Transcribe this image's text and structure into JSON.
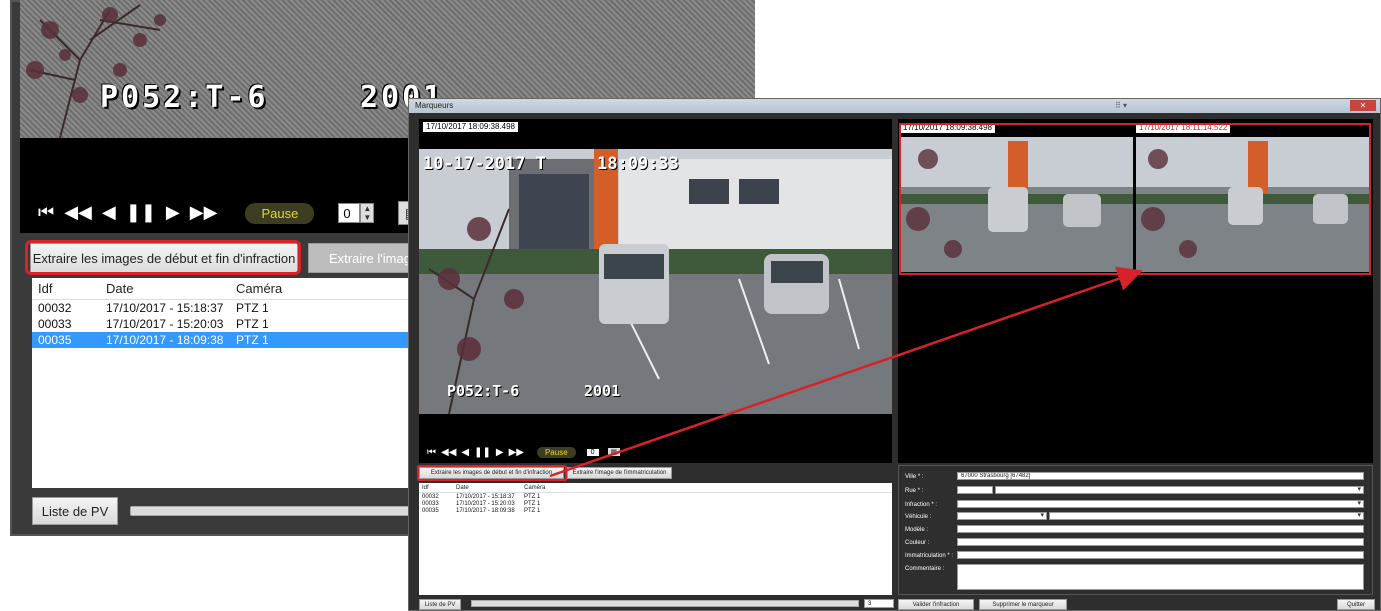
{
  "background_window": {
    "overlay_plate": "P052:T-6",
    "overlay_year": "2001",
    "controls": {
      "first": "⏮",
      "prev_fast": "◀◀",
      "prev": "◀",
      "pause_icon": "❚❚",
      "play": "▶",
      "next_fast": "▶▶",
      "pause_label": "Pause",
      "speed_value": "0"
    },
    "buttons": {
      "extract_label": "Extraire les images de début et fin d'infraction",
      "immat_label": "Extraire l'image d"
    },
    "table": {
      "headers": [
        "Idf",
        "Date",
        "Caméra"
      ],
      "rows": [
        {
          "idf": "00032",
          "date": "17/10/2017 - 15:18:37",
          "camera": "PTZ 1"
        },
        {
          "idf": "00033",
          "date": "17/10/2017 - 15:20:03",
          "camera": "PTZ 1"
        },
        {
          "idf": "00035",
          "date": "17/10/2017 - 18:09:38",
          "camera": "PTZ 1",
          "selected": true
        }
      ]
    },
    "footer": {
      "pv_label": "Liste de PV"
    }
  },
  "foreground_window": {
    "title": "Marqueurs",
    "video": {
      "timestamp": "17/10/2017  18:09:38.498",
      "osd_date": "10-17-2017 T",
      "osd_time": "18:09:33",
      "osd_plate": "P052:T-6",
      "osd_year": "2001"
    },
    "side_images": {
      "left_timestamp": "17/10/2017 18:09:38.498",
      "right_timestamp": "17/10/2017 18:11:14.522"
    },
    "controls": {
      "pause_label": "Pause",
      "speed_value": "0"
    },
    "buttons": {
      "extract_label": "Extraire les images de début et fin d'infraction",
      "immat_label": "Extraire l'image de l'immatriculation"
    },
    "table": {
      "headers": [
        "Idf",
        "Date",
        "Caméra"
      ],
      "rows": [
        {
          "idf": "00032",
          "date": "17/10/2017 - 15:18:37",
          "camera": "PTZ 1"
        },
        {
          "idf": "00033",
          "date": "17/10/2017 - 15:20:03",
          "camera": "PTZ 1"
        },
        {
          "idf": "00035",
          "date": "17/10/2017 - 18:09:38",
          "camera": "PTZ 1"
        }
      ]
    },
    "form": {
      "ville_label": "Ville * :",
      "ville_value": "67000 Strasbourg [67482]",
      "rue_label": "Rue * :",
      "infraction_label": "Infraction * :",
      "vehicule_label": "Véhicule :",
      "modele_label": "Modèle :",
      "couleur_label": "Couleur :",
      "immat_label": "Immatriculation * :",
      "commentaire_label": "Commentaire :"
    },
    "footer": {
      "pv_label": "Liste de PV",
      "count": "3",
      "valider_label": "Valider l'infraction",
      "supprimer_label": "Supprimer le marqueur",
      "quitter_label": "Quitter"
    }
  },
  "colors": {
    "highlight_red": "#d8222a",
    "selection_blue": "#3399ff",
    "pause_text": "#e4d733"
  }
}
